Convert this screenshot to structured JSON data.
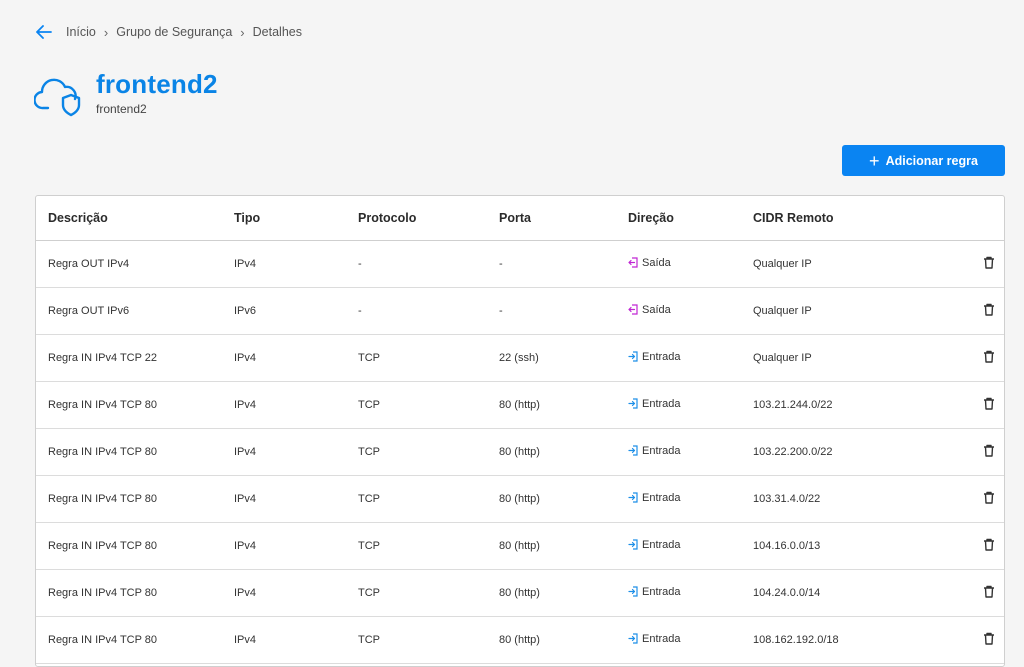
{
  "breadcrumb": {
    "items": [
      "Início",
      "Grupo de Segurança",
      "Detalhes"
    ]
  },
  "header": {
    "title": "frontend2",
    "subtitle": "frontend2"
  },
  "toolbar": {
    "add_label": "Adicionar regra"
  },
  "table": {
    "columns": [
      "Descrição",
      "Tipo",
      "Protocolo",
      "Porta",
      "Direção",
      "CIDR Remoto"
    ],
    "rows": [
      {
        "descricao": "Regra OUT IPv4",
        "tipo": "IPv4",
        "protocolo": "-",
        "porta": "-",
        "direcao": "Saída",
        "cidr": "Qualquer IP"
      },
      {
        "descricao": "Regra OUT IPv6",
        "tipo": "IPv6",
        "protocolo": "-",
        "porta": "-",
        "direcao": "Saída",
        "cidr": "Qualquer IP"
      },
      {
        "descricao": "Regra IN IPv4 TCP 22",
        "tipo": "IPv4",
        "protocolo": "TCP",
        "porta": "22 (ssh)",
        "direcao": "Entrada",
        "cidr": "Qualquer IP"
      },
      {
        "descricao": "Regra IN IPv4 TCP 80",
        "tipo": "IPv4",
        "protocolo": "TCP",
        "porta": "80 (http)",
        "direcao": "Entrada",
        "cidr": "103.21.244.0/22"
      },
      {
        "descricao": "Regra IN IPv4 TCP 80",
        "tipo": "IPv4",
        "protocolo": "TCP",
        "porta": "80 (http)",
        "direcao": "Entrada",
        "cidr": "103.22.200.0/22"
      },
      {
        "descricao": "Regra IN IPv4 TCP 80",
        "tipo": "IPv4",
        "protocolo": "TCP",
        "porta": "80 (http)",
        "direcao": "Entrada",
        "cidr": "103.31.4.0/22"
      },
      {
        "descricao": "Regra IN IPv4 TCP 80",
        "tipo": "IPv4",
        "protocolo": "TCP",
        "porta": "80 (http)",
        "direcao": "Entrada",
        "cidr": "104.16.0.0/13"
      },
      {
        "descricao": "Regra IN IPv4 TCP 80",
        "tipo": "IPv4",
        "protocolo": "TCP",
        "porta": "80 (http)",
        "direcao": "Entrada",
        "cidr": "104.24.0.0/14"
      },
      {
        "descricao": "Regra IN IPv4 TCP 80",
        "tipo": "IPv4",
        "protocolo": "TCP",
        "porta": "80 (http)",
        "direcao": "Entrada",
        "cidr": "108.162.192.0/18"
      }
    ]
  },
  "icons": {
    "back": "arrow-left-icon",
    "logo": "cloud-shield-icon",
    "add": "plus-icon",
    "egress": "egress-icon",
    "ingress": "ingress-icon",
    "delete": "trash-icon"
  },
  "colors": {
    "accent": "#0a84f2",
    "title": "#0a84e6",
    "egress": "#c026d3",
    "ingress": "#1d8fe8"
  }
}
